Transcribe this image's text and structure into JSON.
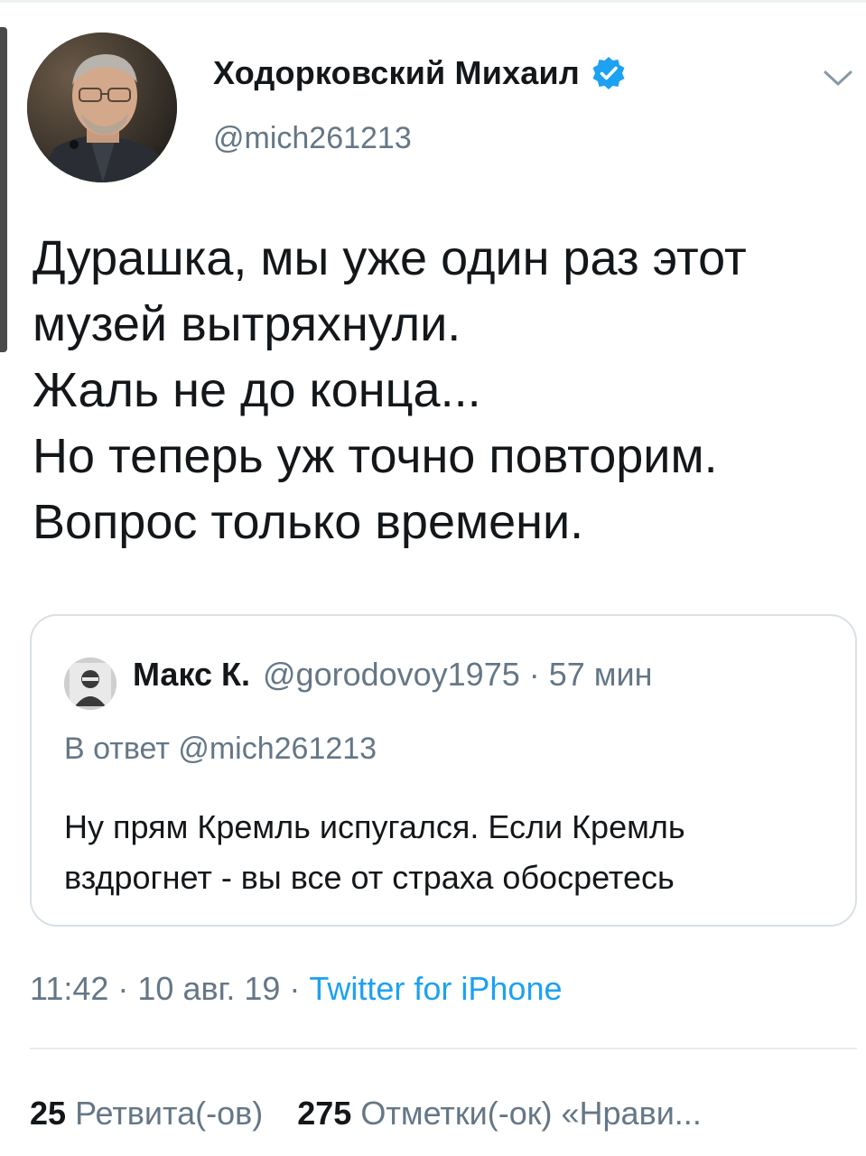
{
  "author": {
    "name": "Ходорковский Михаил",
    "handle": "@mich261213",
    "verified": true
  },
  "tweet": {
    "lines": [
      "Дурашка, мы уже один раз этот",
      "музей вытряхнули.",
      "Жаль не до конца...",
      "Но теперь уж точно повторим.",
      "Вопрос только времени."
    ]
  },
  "quoted_tweet": {
    "name": "Макс К.",
    "handle_time": "@gorodovoy1975 · 57 мин",
    "reply_to": "В ответ @mich261213",
    "lines": [
      "Ну прям Кремль испугался. Если Кремль",
      "вздрогнет - вы все от страха обосретесь"
    ]
  },
  "meta": {
    "datetime": "11:42 · 10 авг. 19 · ",
    "source": "Twitter for iPhone"
  },
  "stats": {
    "retweets_count": "25",
    "retweets_label": "Ретвита(-ов)",
    "likes_count": "275",
    "likes_label": "Отметки(-ок) «Нрави..."
  },
  "colors": {
    "text": "#14171a",
    "secondary": "#657786",
    "accent": "#1da1f2",
    "border": "#d9e0e6"
  },
  "icons": {
    "verified": "verified-badge-icon",
    "more": "chevron-down-icon"
  }
}
